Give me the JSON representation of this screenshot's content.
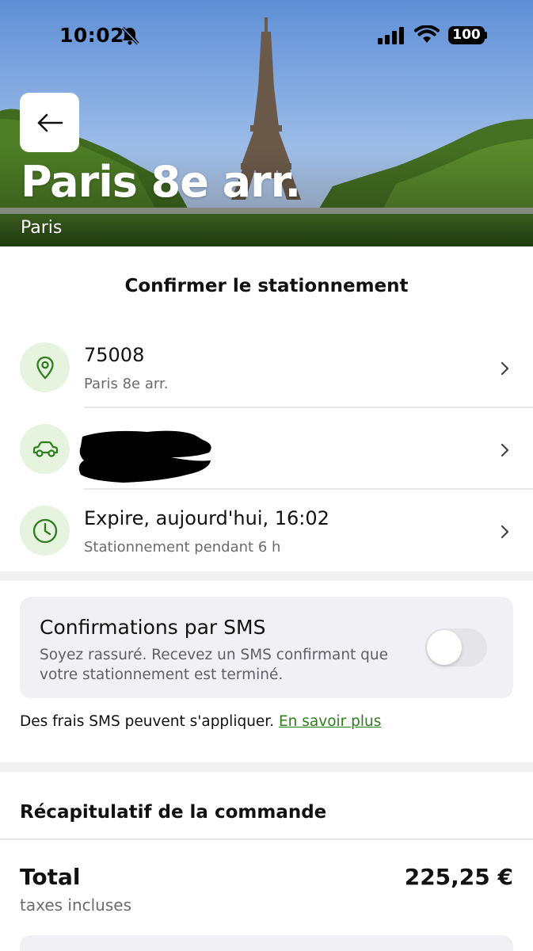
{
  "status_bar": {
    "time": "10:02",
    "battery": "100"
  },
  "hero": {
    "title": "Paris 8e arr.",
    "subtitle": "Paris"
  },
  "confirm": {
    "title": "Confirmer le stationnement",
    "location": {
      "main": "75008",
      "sub": "Paris 8e arr."
    },
    "vehicle": {
      "main": "",
      "sub": ""
    },
    "time": {
      "main": "Expire, aujourd'hui, 16:02",
      "sub": "Stationnement pendant 6 h"
    }
  },
  "sms": {
    "title": "Confirmations par SMS",
    "description": "Soyez rassuré. Recevez un SMS confirmant que votre stationnement est terminé.",
    "enabled": false
  },
  "fees": {
    "text": "Des frais SMS peuvent s'appliquer. ",
    "link": "En savoir plus"
  },
  "summary": {
    "title": "Récapitulatif de la commande",
    "total_label": "Total",
    "total_value": "225,25 €",
    "total_sub": "taxes incluses"
  },
  "colors": {
    "accent": "#2e7d1e",
    "icon_bg": "#e6f3df",
    "card_bg": "#f1f1f5"
  },
  "icons": [
    "back-arrow-icon",
    "location-pin-icon",
    "car-icon",
    "clock-icon",
    "chevron-right-icon",
    "bell-off-icon",
    "signal-icon",
    "wifi-icon"
  ]
}
